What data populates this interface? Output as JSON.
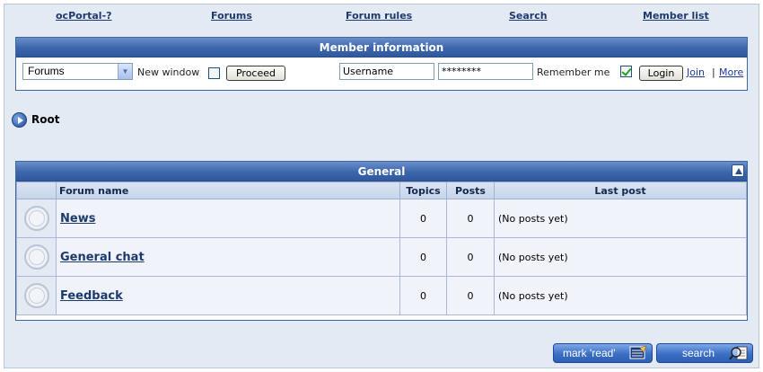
{
  "topnav": {
    "items": [
      {
        "label": "ocPortal-?"
      },
      {
        "label": "Forums"
      },
      {
        "label": "Forum rules"
      },
      {
        "label": "Search"
      },
      {
        "label": "Member list"
      }
    ]
  },
  "member": {
    "title": "Member information",
    "forum_select": "Forums",
    "new_window_label": "New window",
    "new_window_checked": false,
    "proceed_label": "Proceed",
    "username_value": "Username",
    "password_value": "********",
    "remember_label": "Remember me",
    "remember_checked": true,
    "login_label": "Login",
    "join_label": "Join",
    "separator": "|",
    "more_label": "More"
  },
  "breadcrumb": {
    "root_label": "Root"
  },
  "forum_table": {
    "title": "General",
    "columns": {
      "name": "Forum name",
      "topics": "Topics",
      "posts": "Posts",
      "last_post": "Last post"
    },
    "rows": [
      {
        "name": "News",
        "topics": "0",
        "posts": "0",
        "last_post": "(No posts yet)"
      },
      {
        "name": "General chat",
        "topics": "0",
        "posts": "0",
        "last_post": "(No posts yet)"
      },
      {
        "name": "Feedback",
        "topics": "0",
        "posts": "0",
        "last_post": "(No posts yet)"
      }
    ]
  },
  "actions": {
    "mark_read_label": "mark 'read'",
    "search_label": "search"
  },
  "colors": {
    "header_blue": "#3c66ab",
    "link": "#1d3a6e",
    "page_bg": "#e4eaf4"
  }
}
